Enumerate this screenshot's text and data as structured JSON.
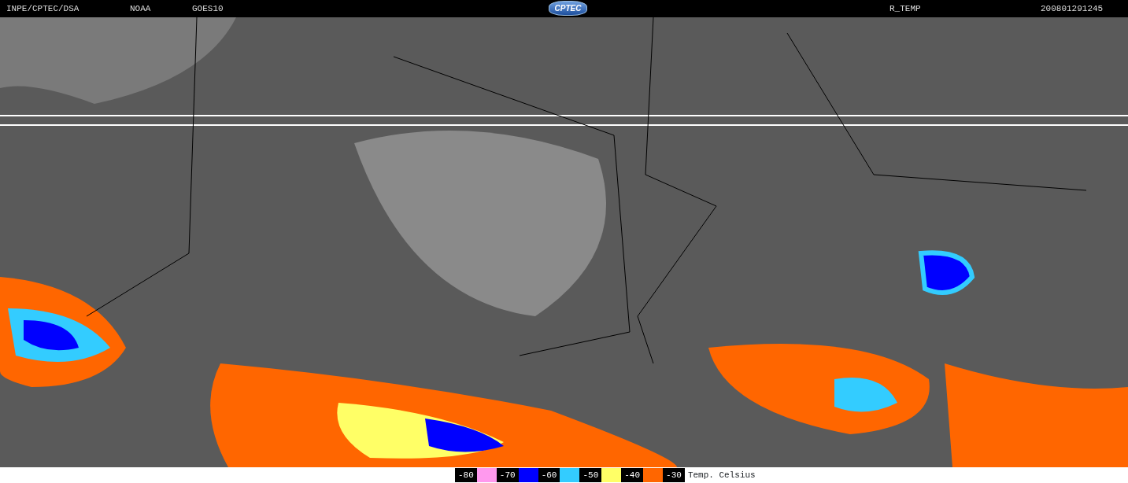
{
  "header": {
    "left_labels": [
      "INPE/CPTEC/DSA",
      "NOAA",
      "GOES10"
    ],
    "logo": "CPTEC",
    "product": "R_TEMP",
    "timestamp": "200801291245"
  },
  "legend": {
    "items": [
      {
        "label": "-80",
        "color": "#ff99ee"
      },
      {
        "label": "-70",
        "color": "#0000ff"
      },
      {
        "label": "-60",
        "color": "#33ccff"
      },
      {
        "label": "-50",
        "color": "#ffff66"
      },
      {
        "label": "-40",
        "color": "#ff6600"
      },
      {
        "label": "-30"
      }
    ],
    "unit": "Temp. Celsius"
  }
}
